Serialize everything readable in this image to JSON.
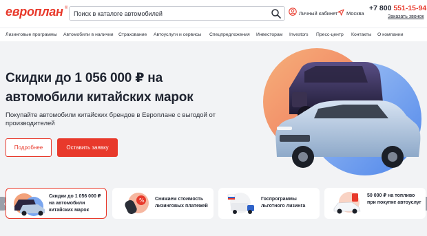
{
  "header": {
    "logo_text": "европлан",
    "logo_mark": "®",
    "search_placeholder": "Поиск в каталоге автомобилей",
    "cabinet_label": "Личный кабинет",
    "city_label": "Москва",
    "phone_prefix": "+7 800 ",
    "phone_number": "551-15-94",
    "callback_label": "Заказать звонок"
  },
  "nav": {
    "items": [
      "Лизинговые программы",
      "Автомобили в наличии",
      "Страхование",
      "Автоуслуги и сервисы",
      "Спецпредложения",
      "Инвесторам",
      "Investors",
      "Пресс-центр",
      "Контакты",
      "О компании"
    ]
  },
  "hero": {
    "title": "Скидки до 1 056 000 ₽ на автомобили китайских марок",
    "subtitle": "Покупайте автомобили китайских брендов в Европлане с выгодой от производителей",
    "more_label": "Подробнее",
    "apply_label": "Оставить заявку"
  },
  "cards": [
    "Скидки до 1 056 000 ₽ на автомобили китайских марок",
    "Снижаем стоимость лизинговых платежей",
    "Госпрограммы льготного лизинга",
    "50 000 ₽ на топливо при покупке автоуслуг"
  ],
  "colors": {
    "accent": "#e8392b",
    "hero_bg": "#f2f3f5",
    "text": "#1f2430"
  },
  "icons": [
    "search-icon",
    "user-icon",
    "location-arrow-icon",
    "chevron-left-icon",
    "chevron-right-icon"
  ]
}
